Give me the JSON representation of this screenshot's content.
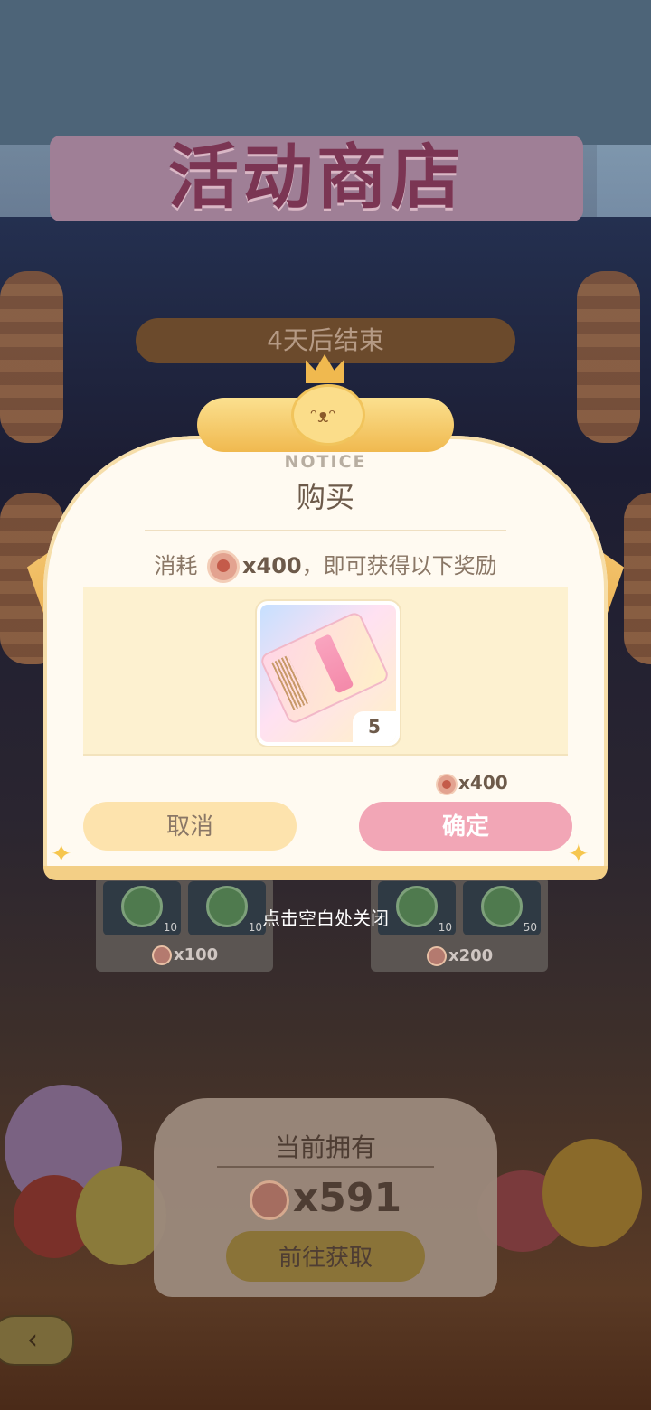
{
  "background": {
    "shop_title": "活动商店",
    "end_text": "4天后结束",
    "cards": [
      {
        "price_label": "x100",
        "slot_counts": [
          "10",
          "10"
        ]
      },
      {
        "price_label": "x200",
        "slot_counts": [
          "10",
          "50"
        ]
      }
    ],
    "close_hint": "点击空白处关闭",
    "owned": {
      "title": "当前拥有",
      "count_label": "x591",
      "goto_label": "前往获取"
    },
    "back_icon": "back-arrow-icon"
  },
  "dialog": {
    "notice_label": "NOTICE",
    "title": "购买",
    "cost_prefix": "消耗",
    "cost_amount": "x400",
    "cost_suffix": "，即可获得以下奖励",
    "reward": {
      "icon": "ticket-icon",
      "count": "5"
    },
    "price_label": "x400",
    "cancel_label": "取消",
    "confirm_label": "确定"
  },
  "colors": {
    "confirm": "#f2a6b6",
    "cancel": "#fde3ad",
    "dialog_bg": "#fffaf1"
  }
}
